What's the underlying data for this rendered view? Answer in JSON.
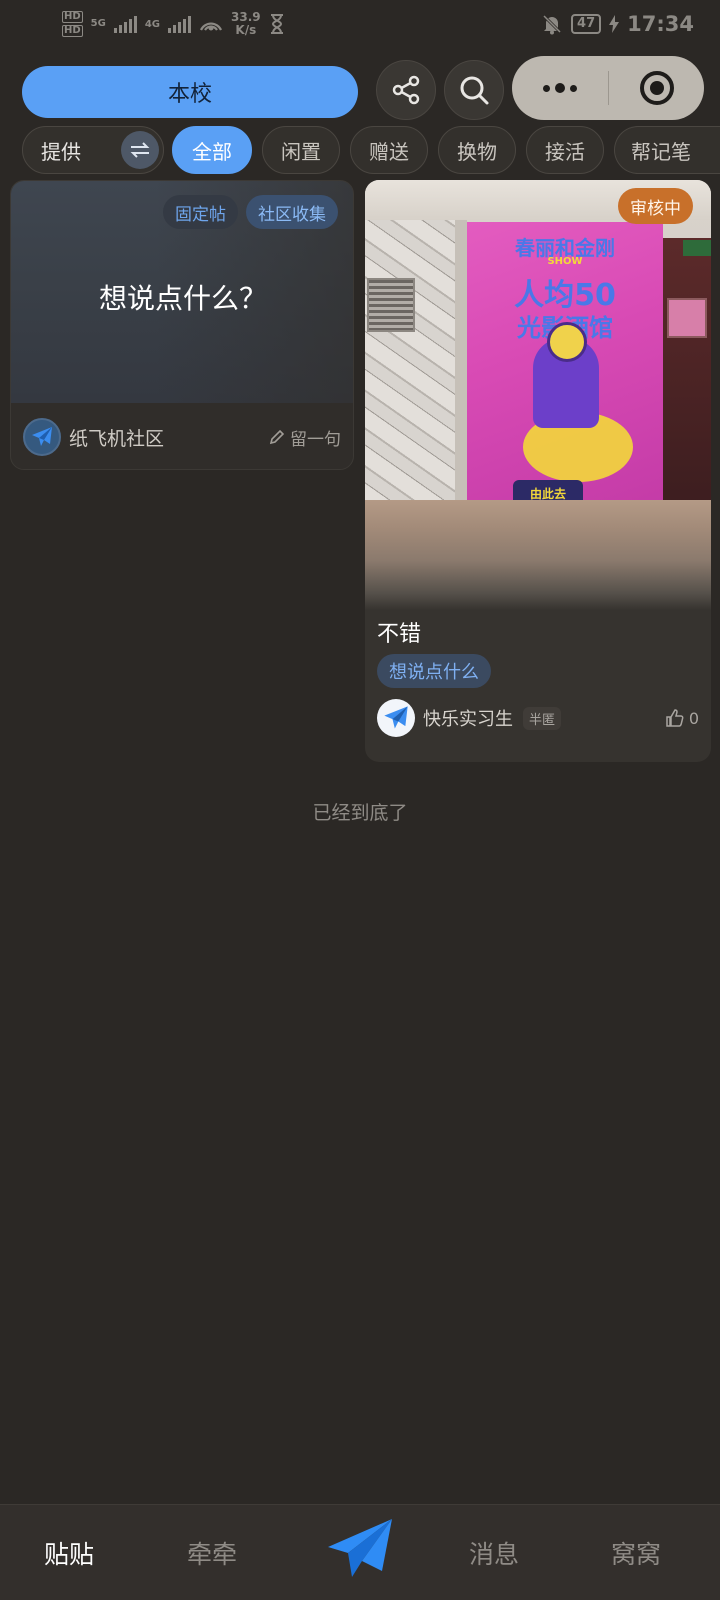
{
  "status_bar": {
    "hd1": "HD",
    "hd2": "HD",
    "net1": "5G",
    "net2": "4G",
    "speed_value": "33.9",
    "speed_unit": "K/s",
    "battery": "47",
    "time": "17:34"
  },
  "header": {
    "school_label": "本校",
    "share_icon": "share-icon",
    "search_icon": "search-icon"
  },
  "filter": {
    "provide_label": "提供",
    "chips": [
      "全部",
      "闲置",
      "赠送",
      "换物",
      "接活",
      "帮记笔"
    ],
    "active_index": 0
  },
  "posts": {
    "left": {
      "tag_fixed": "固定帖",
      "tag_collect": "社区收集",
      "prompt": "想说点什么？",
      "author": "纸飞机社区",
      "reply": "留一句"
    },
    "right": {
      "badge": "审核中",
      "poster_line1": "春丽和金刚",
      "poster_line2": "SHOW",
      "poster_line3": "人均50",
      "poster_line4": "光影酒馆",
      "poster_button": "由此去",
      "title": "不错",
      "tag": "想说点什么",
      "author": "快乐实习生",
      "anon": "半匿",
      "likes": "0"
    }
  },
  "end_text": "已经到底了",
  "tabbar": {
    "tabs": [
      "贴贴",
      "牵牵",
      "消息",
      "窝窝"
    ],
    "active": "贴贴"
  },
  "colors": {
    "accent": "#5aa0f5",
    "review_badge": "#c8702a",
    "background": "#2b2825"
  }
}
